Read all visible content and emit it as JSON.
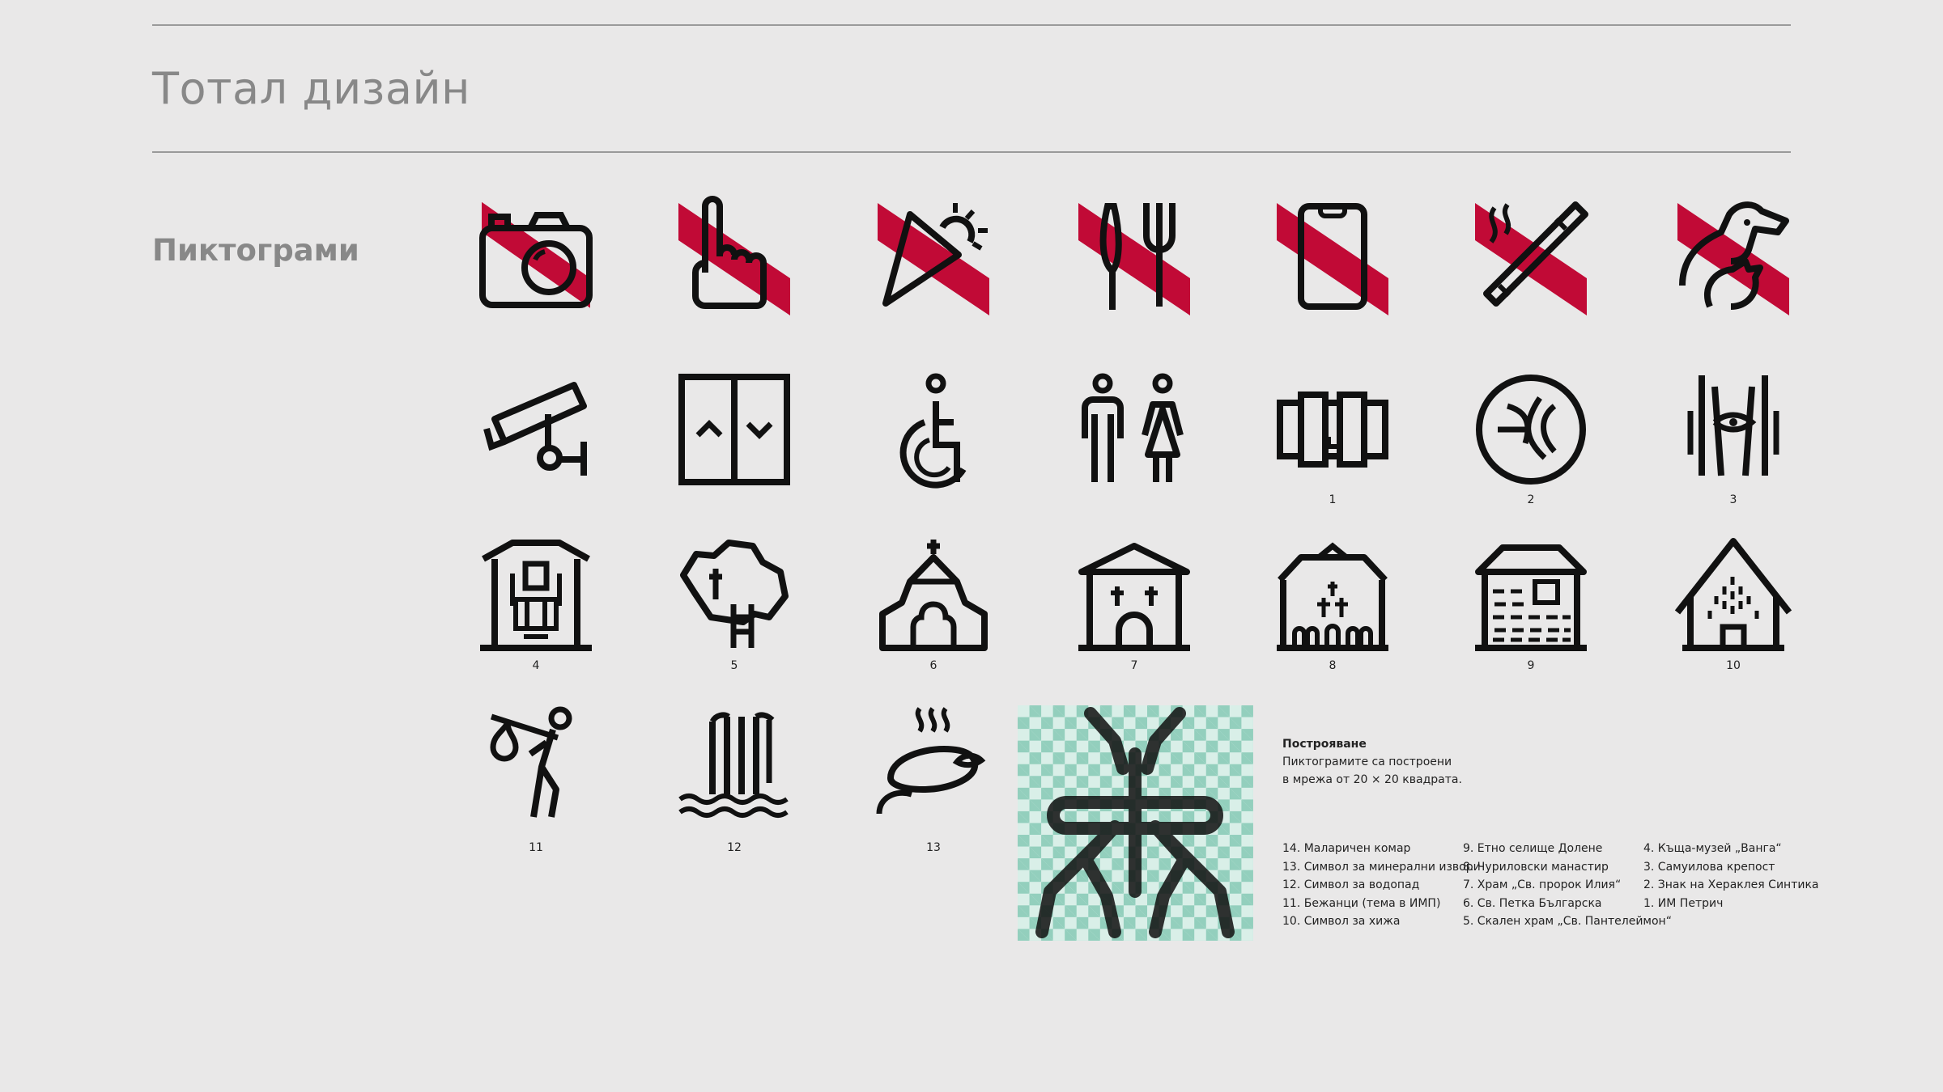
{
  "header": {
    "title": "Тотал дизайн"
  },
  "section": {
    "title": "Пиктограми"
  },
  "colors": {
    "accent": "#c10a36",
    "ink": "#111111",
    "grid": "#93cfbd",
    "heading": "#888888"
  },
  "icons": [
    {
      "name": "no-photography-icon",
      "prohibited": true
    },
    {
      "name": "no-touching-icon",
      "prohibited": true
    },
    {
      "name": "no-flash-icon",
      "prohibited": true
    },
    {
      "name": "no-food-icon",
      "prohibited": true
    },
    {
      "name": "no-phone-icon",
      "prohibited": true
    },
    {
      "name": "no-smoking-icon",
      "prohibited": true
    },
    {
      "name": "no-pets-icon",
      "prohibited": true
    },
    {
      "name": "security-camera-icon"
    },
    {
      "name": "elevator-icon"
    },
    {
      "name": "wheelchair-icon"
    },
    {
      "name": "restroom-icon"
    },
    {
      "name": "museum-building-icon",
      "number": "1"
    },
    {
      "name": "fortress-emblem-icon",
      "number": "2"
    },
    {
      "name": "heraclea-sign-icon",
      "number": "3"
    },
    {
      "name": "vanga-house-icon",
      "number": "4"
    },
    {
      "name": "rock-church-icon",
      "number": "5"
    },
    {
      "name": "church-icon",
      "number": "6"
    },
    {
      "name": "temple-icon",
      "number": "7"
    },
    {
      "name": "monastery-icon",
      "number": "8"
    },
    {
      "name": "village-house-icon",
      "number": "9"
    },
    {
      "name": "hut-icon",
      "number": "10"
    },
    {
      "name": "refugee-icon",
      "number": "11"
    },
    {
      "name": "waterfall-icon",
      "number": "12"
    },
    {
      "name": "mineral-spring-icon",
      "number": "13"
    }
  ],
  "construction": {
    "heading": "Построяване",
    "lines": [
      "Пиктограмите са построени",
      "в мрежа от 20 × 20 квадрата."
    ]
  },
  "legend": {
    "col1": [
      "14. Маларичен комар",
      "13. Символ за минерални извори",
      "12. Символ за водопад",
      "11. Бежанци (тема в ИМП)",
      "10. Символ за хижа"
    ],
    "col2": [
      "9. Етно селище Долене",
      "8. Чуриловски манастир",
      "7. Храм „Св. пророк Илия“",
      "6. Св. Петка Българска",
      "5. Скален храм „Св. Пантелеймон“"
    ],
    "col3": [
      "4. Къща-музей „Ванга“",
      "3. Самуилова крепост",
      "2. Знак на Хераклея Синтика",
      "1. ИМ Петрич"
    ]
  }
}
